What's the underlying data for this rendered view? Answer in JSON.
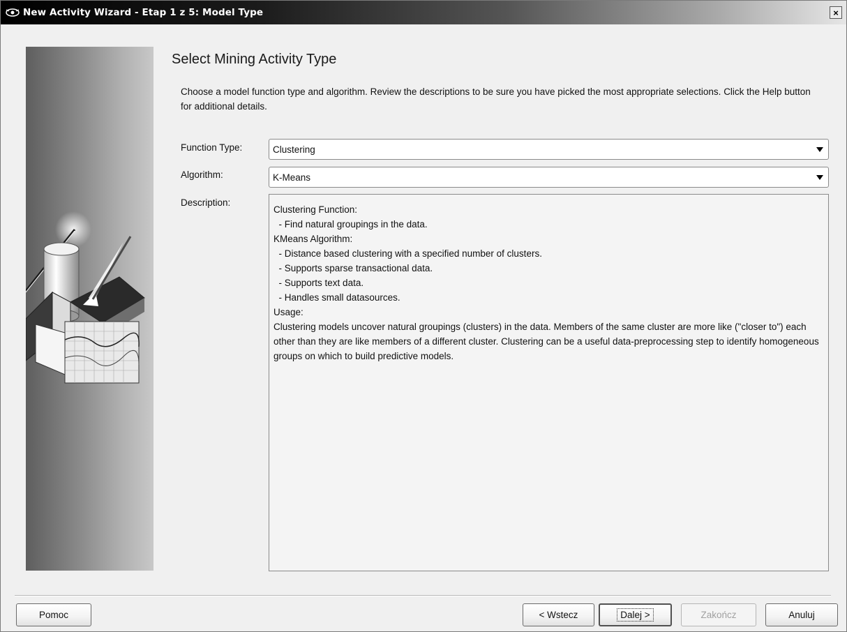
{
  "window": {
    "title": "New Activity Wizard - Etap 1 z 5: Model Type",
    "close_label": "×"
  },
  "page": {
    "title": "Select Mining Activity Type",
    "intro": "Choose a model function type and algorithm.  Review the descriptions to be sure you have picked the most appropriate selections. Click the Help button for additional details."
  },
  "form": {
    "function_type_label": "Function Type:",
    "function_type_value": "Clustering",
    "algorithm_label": "Algorithm:",
    "algorithm_value": "K-Means",
    "description_label": "Description:",
    "description_lines": [
      "Clustering Function:",
      "",
      "  - Find natural groupings in the data.",
      "",
      "KMeans Algorithm:",
      "",
      "  - Distance based clustering with a specified number of clusters.",
      "  - Supports sparse transactional data.",
      "  - Supports text data.",
      "  - Handles small datasources.",
      "",
      "Usage:",
      "",
      "Clustering models uncover natural groupings (clusters) in the data. Members of the same cluster are more like (\"closer to\") each other than they are like members of a different cluster. Clustering can be a useful data-preprocessing step to identify homogeneous groups on which to build predictive models."
    ]
  },
  "buttons": {
    "help": "Pomoc",
    "back": "< Wstecz",
    "next": "Dalej >",
    "finish": "Zakończ",
    "cancel": "Anuluj"
  },
  "icons": {
    "title_icon": "wizard-eye-icon",
    "side_image": "database-chart-illustration"
  }
}
